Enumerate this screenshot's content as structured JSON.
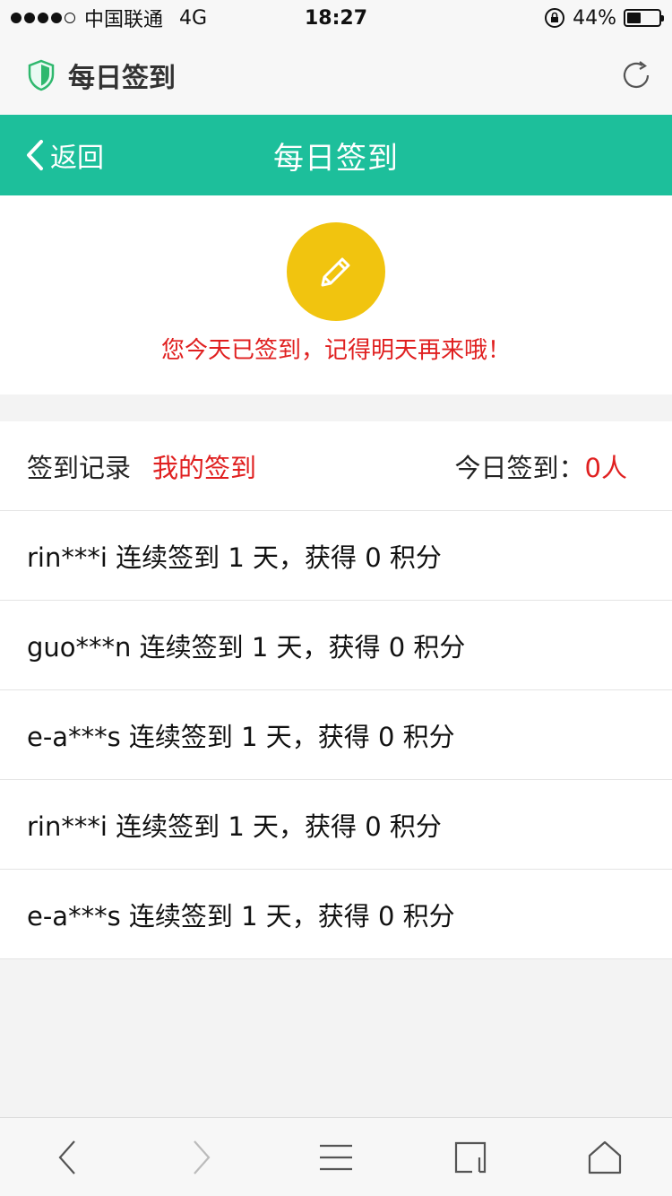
{
  "status_bar": {
    "carrier": "中国联通",
    "network": "4G",
    "time": "18:27",
    "battery": "44%",
    "battery_level": 0.44
  },
  "browser": {
    "title": "每日签到",
    "shield_icon": "shield-icon",
    "refresh_icon": "refresh-icon"
  },
  "header": {
    "back_label": "返回",
    "title": "每日签到"
  },
  "signin": {
    "icon": "pencil-icon",
    "message": "您今天已签到，记得明天再来哦！",
    "accent": "#f1c40f"
  },
  "records": {
    "label": "签到记录",
    "tab": "我的签到",
    "today_label": "今日签到：",
    "today_count": "0人",
    "rows": [
      "rin***i 连续签到 1 天，获得 0 积分",
      "guo***n 连续签到 1 天，获得 0 积分",
      "e-a***s 连续签到 1 天，获得 0 积分",
      "rin***i 连续签到 1 天，获得 0 积分",
      "e-a***s 连续签到 1 天，获得 0 积分"
    ]
  },
  "toolbar": {
    "items": [
      "back-icon",
      "forward-icon",
      "menu-icon",
      "tabs-icon",
      "home-icon"
    ]
  },
  "colors": {
    "brand": "#1dbf9b",
    "highlight": "#e02020"
  }
}
